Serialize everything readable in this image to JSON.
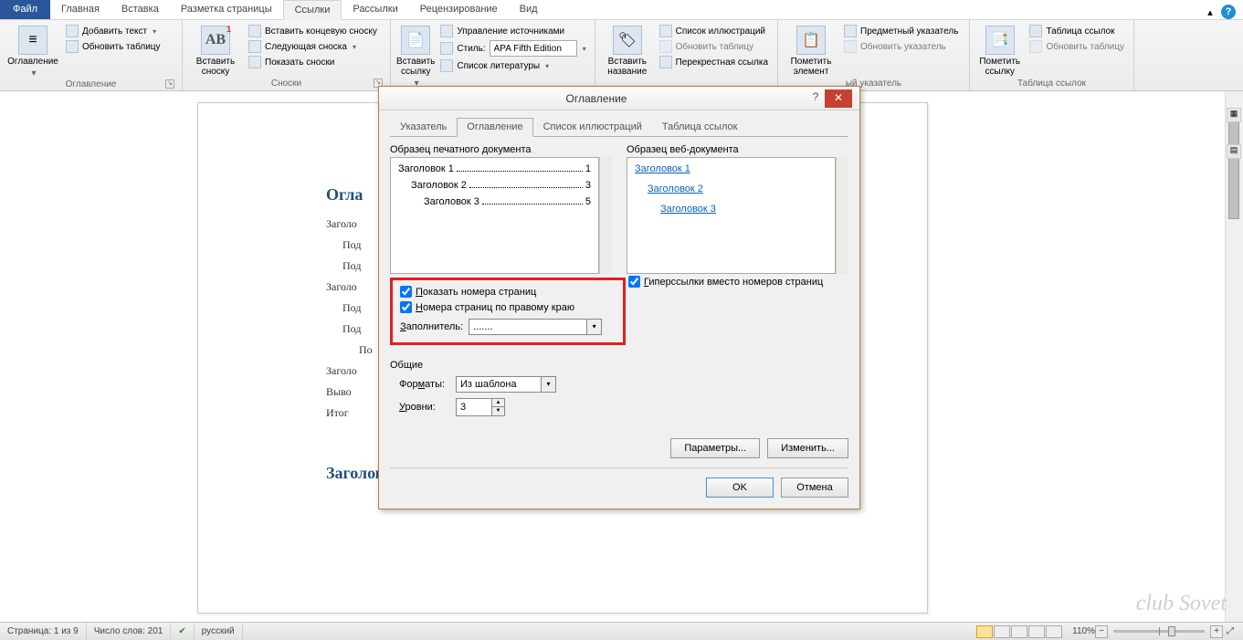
{
  "tabs": {
    "file": "Файл",
    "items": [
      "Главная",
      "Вставка",
      "Разметка страницы",
      "Ссылки",
      "Рассылки",
      "Рецензирование",
      "Вид"
    ],
    "active_index": 3
  },
  "ribbon": {
    "toc": {
      "big": "Оглавление",
      "add_text": "Добавить текст",
      "update": "Обновить таблицу",
      "group": "Оглавление"
    },
    "footnotes": {
      "big": "Вставить\nсноску",
      "endnote": "Вставить концевую сноску",
      "next": "Следующая сноска",
      "show": "Показать сноски",
      "group": "Сноски",
      "ab": "AB",
      "one": "1"
    },
    "citations": {
      "big": "Вставить\nссылку",
      "manage": "Управление источниками",
      "style_label": "Стиль:",
      "style_value": "APA Fifth Edition",
      "bib": "Список литературы",
      "group": ""
    },
    "captions": {
      "big": "Вставить\nназвание",
      "list": "Список иллюстраций",
      "update": "Обновить таблицу",
      "cross": "Перекрестная ссылка",
      "group": ""
    },
    "index": {
      "big": "Пометить\nэлемент",
      "subject": "Предметный указатель",
      "update": "Обновить указатель",
      "group": "ый указатель"
    },
    "toa": {
      "big": "Пометить\nссылку",
      "table": "Таблица ссылок",
      "update": "Обновить таблицу",
      "group": "Таблица ссылок"
    }
  },
  "doc": {
    "heading": "Огла",
    "lines": [
      "Заголо",
      "Под",
      "Под",
      "Заголо",
      "Под",
      "Под",
      "По",
      "Заголо",
      "Выво",
      "Итог"
    ],
    "heading2": "Заголовок"
  },
  "dialog": {
    "title": "Оглавление",
    "tabs": [
      "Указатель",
      "Оглавление",
      "Список иллюстраций",
      "Таблица ссылок"
    ],
    "active_tab": 1,
    "print_label": "Образец печатного документа",
    "web_label": "Образец веб-документа",
    "print_items": [
      {
        "label": "Заголовок 1",
        "page": "1",
        "indent": 0
      },
      {
        "label": "Заголовок 2",
        "page": "3",
        "indent": 1
      },
      {
        "label": "Заголовок 3",
        "page": "5",
        "indent": 2
      }
    ],
    "web_items": [
      "Заголовок 1",
      "Заголовок 2",
      "Заголовок 3"
    ],
    "chk_show_pages": "Показать номера страниц",
    "chk_right_align": "Номера страниц по правому краю",
    "chk_hyperlinks": "Гиперссылки вместо номеров страниц",
    "leader_label": "Заполнитель:",
    "leader_value": ".......",
    "general_label": "Общие",
    "formats_label": "Форматы:",
    "formats_value": "Из шаблона",
    "levels_label": "Уровни:",
    "levels_value": "3",
    "btn_options": "Параметры...",
    "btn_modify": "Изменить...",
    "btn_ok": "OK",
    "btn_cancel": "Отмена"
  },
  "status": {
    "page": "Страница: 1 из 9",
    "words": "Число слов: 201",
    "lang": "русский",
    "zoom": "110%"
  },
  "watermark": "club Sovet"
}
